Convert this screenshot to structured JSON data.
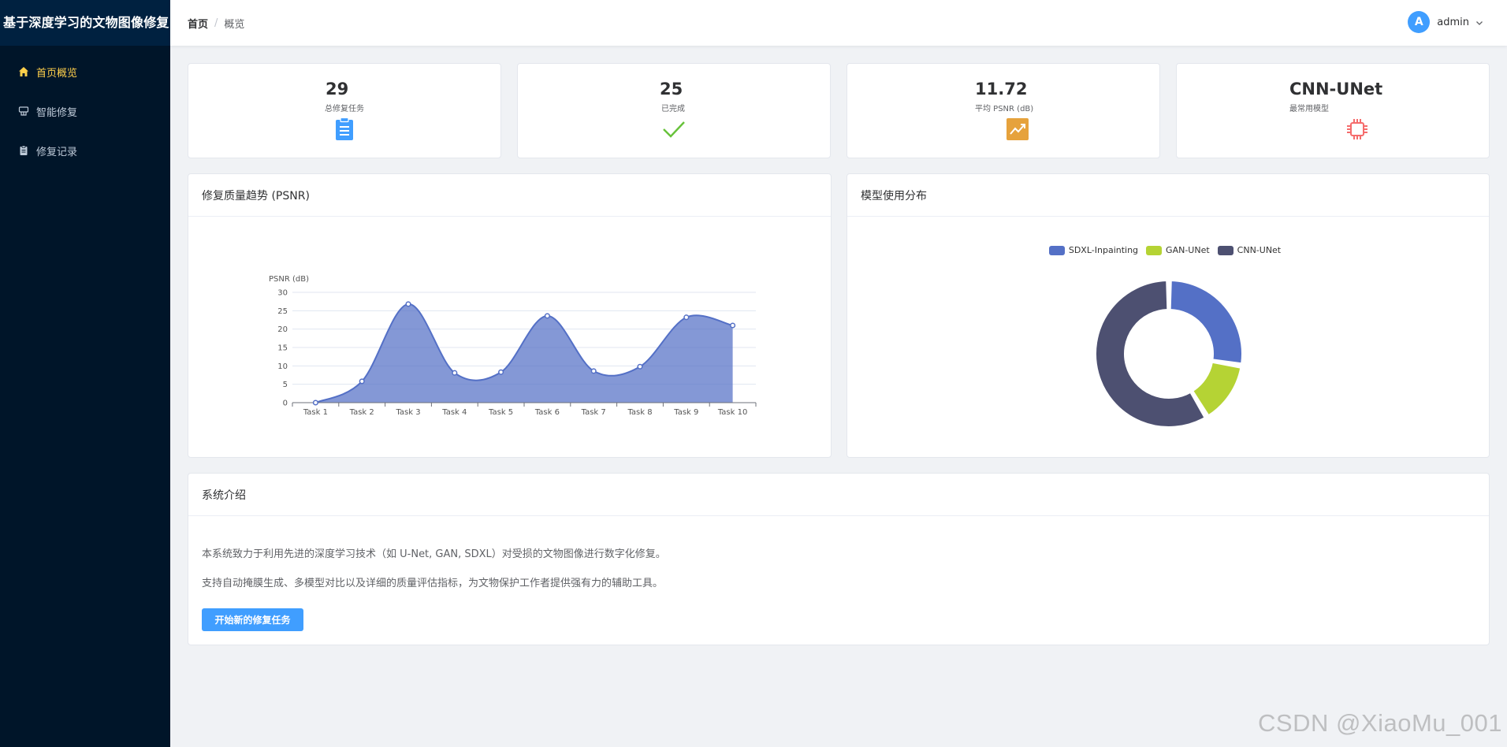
{
  "app": {
    "title": "基于深度学习的文物图像修复"
  },
  "sidebar": {
    "items": [
      {
        "label": "首页概览",
        "icon": "home-icon",
        "active": true
      },
      {
        "label": "智能修复",
        "icon": "brush-icon",
        "active": false
      },
      {
        "label": "修复记录",
        "icon": "clipboard-icon",
        "active": false
      }
    ]
  },
  "header": {
    "breadcrumb": [
      "首页",
      "概览"
    ],
    "user": {
      "avatar_letter": "A",
      "name": "admin"
    }
  },
  "stats": [
    {
      "value": "29",
      "label": "总修复任务",
      "icon": "clipboard-icon",
      "color": "#409eff"
    },
    {
      "value": "25",
      "label": "已完成",
      "icon": "check-icon",
      "color": "#67c23a"
    },
    {
      "value": "11.72",
      "label": "平均 PSNR (dB)",
      "icon": "trend-chart-icon",
      "color": "#e6a23c"
    },
    {
      "value": "CNN-UNet",
      "label": "最常用模型",
      "icon": "cpu-icon",
      "color": "#f56c6c"
    }
  ],
  "trend_panel": {
    "title": "修复质量趋势 (PSNR)"
  },
  "model_panel": {
    "title": "模型使用分布"
  },
  "chart_data": [
    {
      "type": "area",
      "smooth": true,
      "ylabel": "PSNR (dB)",
      "ylim": [
        0,
        30
      ],
      "yticks": [
        0,
        5,
        10,
        15,
        20,
        25,
        30
      ],
      "categories": [
        "Task 1",
        "Task 2",
        "Task 3",
        "Task 4",
        "Task 5",
        "Task 6",
        "Task 7",
        "Task 8",
        "Task 9",
        "Task 10"
      ],
      "values": [
        0,
        5.8,
        26.8,
        8.1,
        8.3,
        23.6,
        8.6,
        9.8,
        23.2,
        21.0
      ],
      "color": "#5470c6",
      "grid": true
    },
    {
      "type": "pie",
      "donut": true,
      "legend_position": "top",
      "series": [
        {
          "name": "SDXL-Inpainting",
          "value": 8,
          "color": "#5470c6"
        },
        {
          "name": "GAN-UNet",
          "value": 4,
          "color": "#b5d334"
        },
        {
          "name": "CNN-UNet",
          "value": 17,
          "color": "#4d5071"
        }
      ]
    }
  ],
  "intro": {
    "title": "系统介绍",
    "line1": "本系统致力于利用先进的深度学习技术（如 U-Net, GAN, SDXL）对受损的文物图像进行数字化修复。",
    "line2": "支持自动掩膜生成、多模型对比以及详细的质量评估指标，为文物保护工作者提供强有力的辅助工具。",
    "button": "开始新的修复任务"
  },
  "watermark": "CSDN @XiaoMu_001"
}
